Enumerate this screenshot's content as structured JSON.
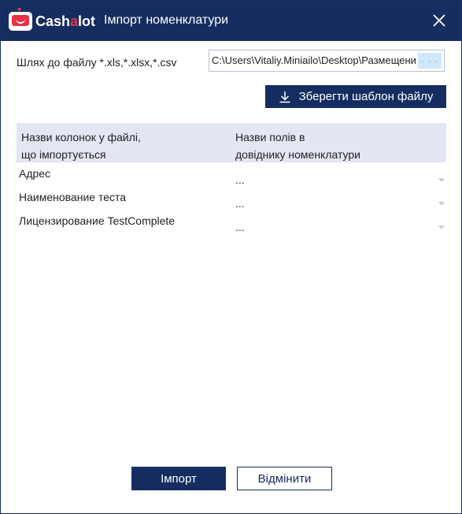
{
  "window": {
    "logo_text_main": "Cash",
    "logo_text_accent": "a",
    "logo_text_end": "lot",
    "title": "Імпорт номенклатури"
  },
  "path": {
    "label": "Шлях до файлу *.xls,*.xlsx,*.csv",
    "value": "C:\\Users\\Vitaliy.Miniailo\\Desktop\\Размещени",
    "browse_label": "- - -"
  },
  "save_template": {
    "label": "Зберегти шаблон файлу"
  },
  "table": {
    "headers": [
      {
        "line1": "Назви колонок у файлі,",
        "line2": "що імпортується"
      },
      {
        "line1": "Назви полів в",
        "line2": "довіднику номенклатури"
      }
    ],
    "rows": [
      {
        "name": "Адрес",
        "value": "..."
      },
      {
        "name": "Наименование теста",
        "value": "..."
      },
      {
        "name": "Лицензирование TestComplete",
        "value": "..."
      }
    ]
  },
  "footer": {
    "import_label": "Імпорт",
    "cancel_label": "Відмінити"
  },
  "colors": {
    "primary": "#162d61",
    "accent": "#e8334a",
    "table_header": "#e3e6f3",
    "browse_button": "#cfe8fb"
  }
}
